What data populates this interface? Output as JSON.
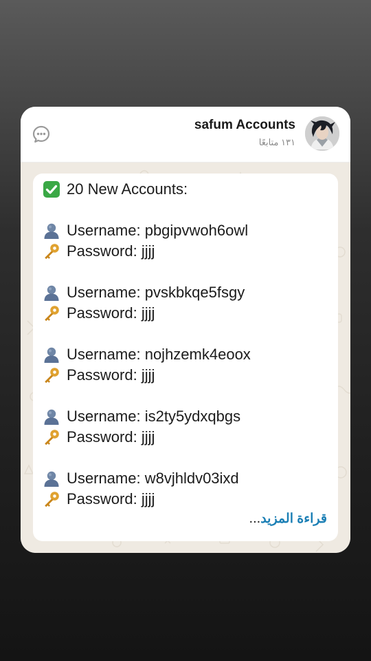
{
  "channel": {
    "title": "safum Accounts",
    "subscribers": "١٣١ متابعًا"
  },
  "message": {
    "heading": "20 New Accounts:",
    "accounts": [
      {
        "username_label": "Username: pbgipvwoh6owl",
        "password_label": "Password: jjjj"
      },
      {
        "username_label": "Username: pvskbkqe5fsgy",
        "password_label": "Password: jjjj"
      },
      {
        "username_label": "Username: nojhzemk4eoox",
        "password_label": "Password: jjjj"
      },
      {
        "username_label": "Username: is2ty5ydxqbgs",
        "password_label": "Password: jjjj"
      },
      {
        "username_label": "Username: w8vjhldv03ixd",
        "password_label": "Password: jjjj"
      }
    ],
    "read_more": "قراءة المزيد",
    "ellipsis": "..."
  },
  "icons": {
    "share": "share-icon",
    "check": "check-mark-icon",
    "user": "user-silhouette-icon",
    "key": "key-icon"
  },
  "colors": {
    "link": "#1b7fb5",
    "check_bg": "#3aa845",
    "chat_background": "#efeae2"
  }
}
